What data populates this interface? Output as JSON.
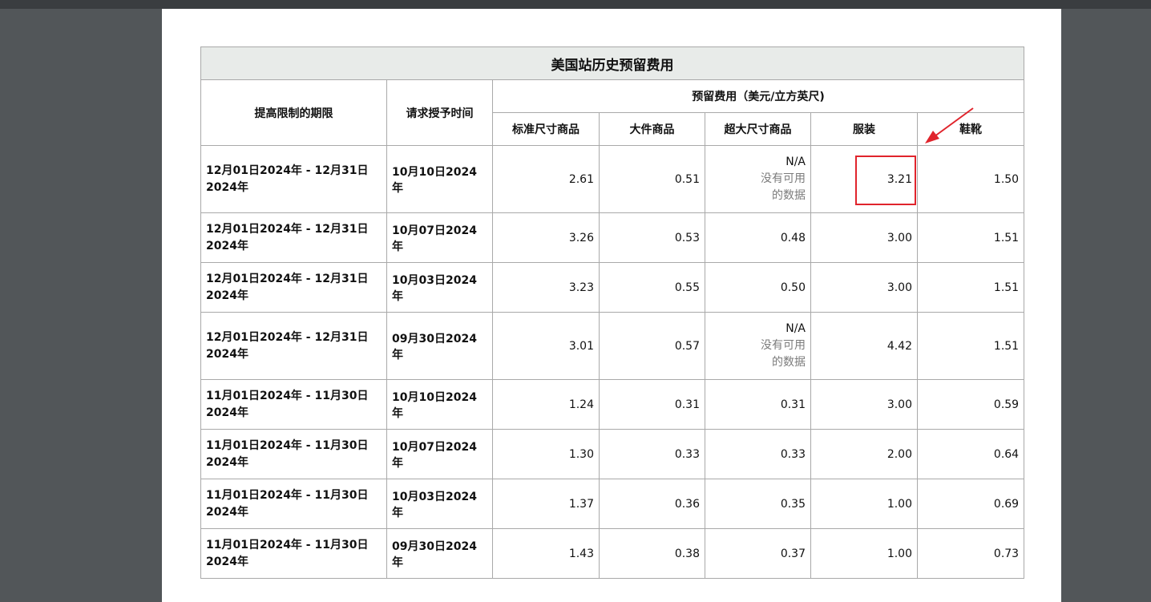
{
  "table": {
    "title": "美国站历史预留费用",
    "col_period": "提高限制的期限",
    "col_request": "请求授予时间",
    "group_label": "预留费用（美元/立方英尺)",
    "categories": [
      "标准尺寸商品",
      "大件商品",
      "超大尺寸商品",
      "服装",
      "鞋靴"
    ],
    "rows": [
      {
        "period": "12月01日2024年 - 12月31日2024年",
        "request": "10月10日2024年",
        "standard": "2.61",
        "large": "0.51",
        "oversize": "N/A",
        "oversize_note": "没有可用的数据",
        "apparel": "3.21",
        "footwear": "1.50"
      },
      {
        "period": "12月01日2024年 - 12月31日2024年",
        "request": "10月07日2024年",
        "standard": "3.26",
        "large": "0.53",
        "oversize": "0.48",
        "oversize_note": "",
        "apparel": "3.00",
        "footwear": "1.51"
      },
      {
        "period": "12月01日2024年 - 12月31日2024年",
        "request": "10月03日2024年",
        "standard": "3.23",
        "large": "0.55",
        "oversize": "0.50",
        "oversize_note": "",
        "apparel": "3.00",
        "footwear": "1.51"
      },
      {
        "period": "12月01日2024年 - 12月31日2024年",
        "request": "09月30日2024年",
        "standard": "3.01",
        "large": "0.57",
        "oversize": "N/A",
        "oversize_note": "没有可用的数据",
        "apparel": "4.42",
        "footwear": "1.51"
      },
      {
        "period": "11月01日2024年 - 11月30日2024年",
        "request": "10月10日2024年",
        "standard": "1.24",
        "large": "0.31",
        "oversize": "0.31",
        "oversize_note": "",
        "apparel": "3.00",
        "footwear": "0.59"
      },
      {
        "period": "11月01日2024年 - 11月30日2024年",
        "request": "10月07日2024年",
        "standard": "1.30",
        "large": "0.33",
        "oversize": "0.33",
        "oversize_note": "",
        "apparel": "2.00",
        "footwear": "0.64"
      },
      {
        "period": "11月01日2024年 - 11月30日2024年",
        "request": "10月03日2024年",
        "standard": "1.37",
        "large": "0.36",
        "oversize": "0.35",
        "oversize_note": "",
        "apparel": "1.00",
        "footwear": "0.69"
      },
      {
        "period": "11月01日2024年 - 11月30日2024年",
        "request": "09月30日2024年",
        "standard": "1.43",
        "large": "0.38",
        "oversize": "0.37",
        "oversize_note": "",
        "apparel": "1.00",
        "footwear": "0.73"
      }
    ]
  },
  "annotation": {
    "highlight_color": "#e0242c"
  }
}
